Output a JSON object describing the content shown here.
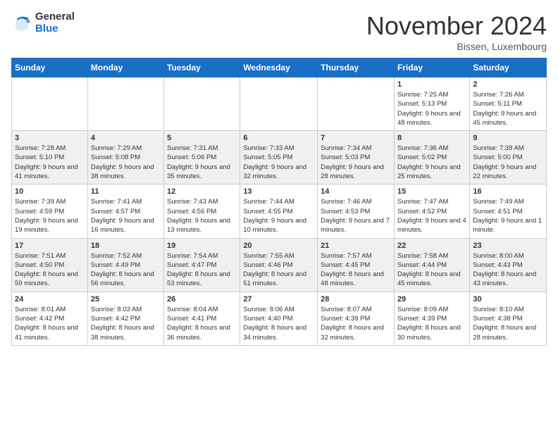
{
  "logo": {
    "general": "General",
    "blue": "Blue"
  },
  "title": "November 2024",
  "location": "Bissen, Luxembourg",
  "headers": [
    "Sunday",
    "Monday",
    "Tuesday",
    "Wednesday",
    "Thursday",
    "Friday",
    "Saturday"
  ],
  "weeks": [
    [
      {
        "day": "",
        "info": ""
      },
      {
        "day": "",
        "info": ""
      },
      {
        "day": "",
        "info": ""
      },
      {
        "day": "",
        "info": ""
      },
      {
        "day": "",
        "info": ""
      },
      {
        "day": "1",
        "info": "Sunrise: 7:25 AM\nSunset: 5:13 PM\nDaylight: 9 hours and 48 minutes."
      },
      {
        "day": "2",
        "info": "Sunrise: 7:26 AM\nSunset: 5:11 PM\nDaylight: 9 hours and 45 minutes."
      }
    ],
    [
      {
        "day": "3",
        "info": "Sunrise: 7:28 AM\nSunset: 5:10 PM\nDaylight: 9 hours and 41 minutes."
      },
      {
        "day": "4",
        "info": "Sunrise: 7:29 AM\nSunset: 5:08 PM\nDaylight: 9 hours and 38 minutes."
      },
      {
        "day": "5",
        "info": "Sunrise: 7:31 AM\nSunset: 5:06 PM\nDaylight: 9 hours and 35 minutes."
      },
      {
        "day": "6",
        "info": "Sunrise: 7:33 AM\nSunset: 5:05 PM\nDaylight: 9 hours and 32 minutes."
      },
      {
        "day": "7",
        "info": "Sunrise: 7:34 AM\nSunset: 5:03 PM\nDaylight: 9 hours and 28 minutes."
      },
      {
        "day": "8",
        "info": "Sunrise: 7:36 AM\nSunset: 5:02 PM\nDaylight: 9 hours and 25 minutes."
      },
      {
        "day": "9",
        "info": "Sunrise: 7:38 AM\nSunset: 5:00 PM\nDaylight: 9 hours and 22 minutes."
      }
    ],
    [
      {
        "day": "10",
        "info": "Sunrise: 7:39 AM\nSunset: 4:59 PM\nDaylight: 9 hours and 19 minutes."
      },
      {
        "day": "11",
        "info": "Sunrise: 7:41 AM\nSunset: 4:57 PM\nDaylight: 9 hours and 16 minutes."
      },
      {
        "day": "12",
        "info": "Sunrise: 7:43 AM\nSunset: 4:56 PM\nDaylight: 9 hours and 13 minutes."
      },
      {
        "day": "13",
        "info": "Sunrise: 7:44 AM\nSunset: 4:55 PM\nDaylight: 9 hours and 10 minutes."
      },
      {
        "day": "14",
        "info": "Sunrise: 7:46 AM\nSunset: 4:53 PM\nDaylight: 9 hours and 7 minutes."
      },
      {
        "day": "15",
        "info": "Sunrise: 7:47 AM\nSunset: 4:52 PM\nDaylight: 9 hours and 4 minutes."
      },
      {
        "day": "16",
        "info": "Sunrise: 7:49 AM\nSunset: 4:51 PM\nDaylight: 9 hours and 1 minute."
      }
    ],
    [
      {
        "day": "17",
        "info": "Sunrise: 7:51 AM\nSunset: 4:50 PM\nDaylight: 8 hours and 59 minutes."
      },
      {
        "day": "18",
        "info": "Sunrise: 7:52 AM\nSunset: 4:49 PM\nDaylight: 8 hours and 56 minutes."
      },
      {
        "day": "19",
        "info": "Sunrise: 7:54 AM\nSunset: 4:47 PM\nDaylight: 8 hours and 53 minutes."
      },
      {
        "day": "20",
        "info": "Sunrise: 7:55 AM\nSunset: 4:46 PM\nDaylight: 8 hours and 51 minutes."
      },
      {
        "day": "21",
        "info": "Sunrise: 7:57 AM\nSunset: 4:45 PM\nDaylight: 8 hours and 48 minutes."
      },
      {
        "day": "22",
        "info": "Sunrise: 7:58 AM\nSunset: 4:44 PM\nDaylight: 8 hours and 45 minutes."
      },
      {
        "day": "23",
        "info": "Sunrise: 8:00 AM\nSunset: 4:43 PM\nDaylight: 8 hours and 43 minutes."
      }
    ],
    [
      {
        "day": "24",
        "info": "Sunrise: 8:01 AM\nSunset: 4:42 PM\nDaylight: 8 hours and 41 minutes."
      },
      {
        "day": "25",
        "info": "Sunrise: 8:03 AM\nSunset: 4:42 PM\nDaylight: 8 hours and 38 minutes."
      },
      {
        "day": "26",
        "info": "Sunrise: 8:04 AM\nSunset: 4:41 PM\nDaylight: 8 hours and 36 minutes."
      },
      {
        "day": "27",
        "info": "Sunrise: 8:06 AM\nSunset: 4:40 PM\nDaylight: 8 hours and 34 minutes."
      },
      {
        "day": "28",
        "info": "Sunrise: 8:07 AM\nSunset: 4:39 PM\nDaylight: 8 hours and 32 minutes."
      },
      {
        "day": "29",
        "info": "Sunrise: 8:09 AM\nSunset: 4:39 PM\nDaylight: 8 hours and 30 minutes."
      },
      {
        "day": "30",
        "info": "Sunrise: 8:10 AM\nSunset: 4:38 PM\nDaylight: 8 hours and 28 minutes."
      }
    ]
  ]
}
